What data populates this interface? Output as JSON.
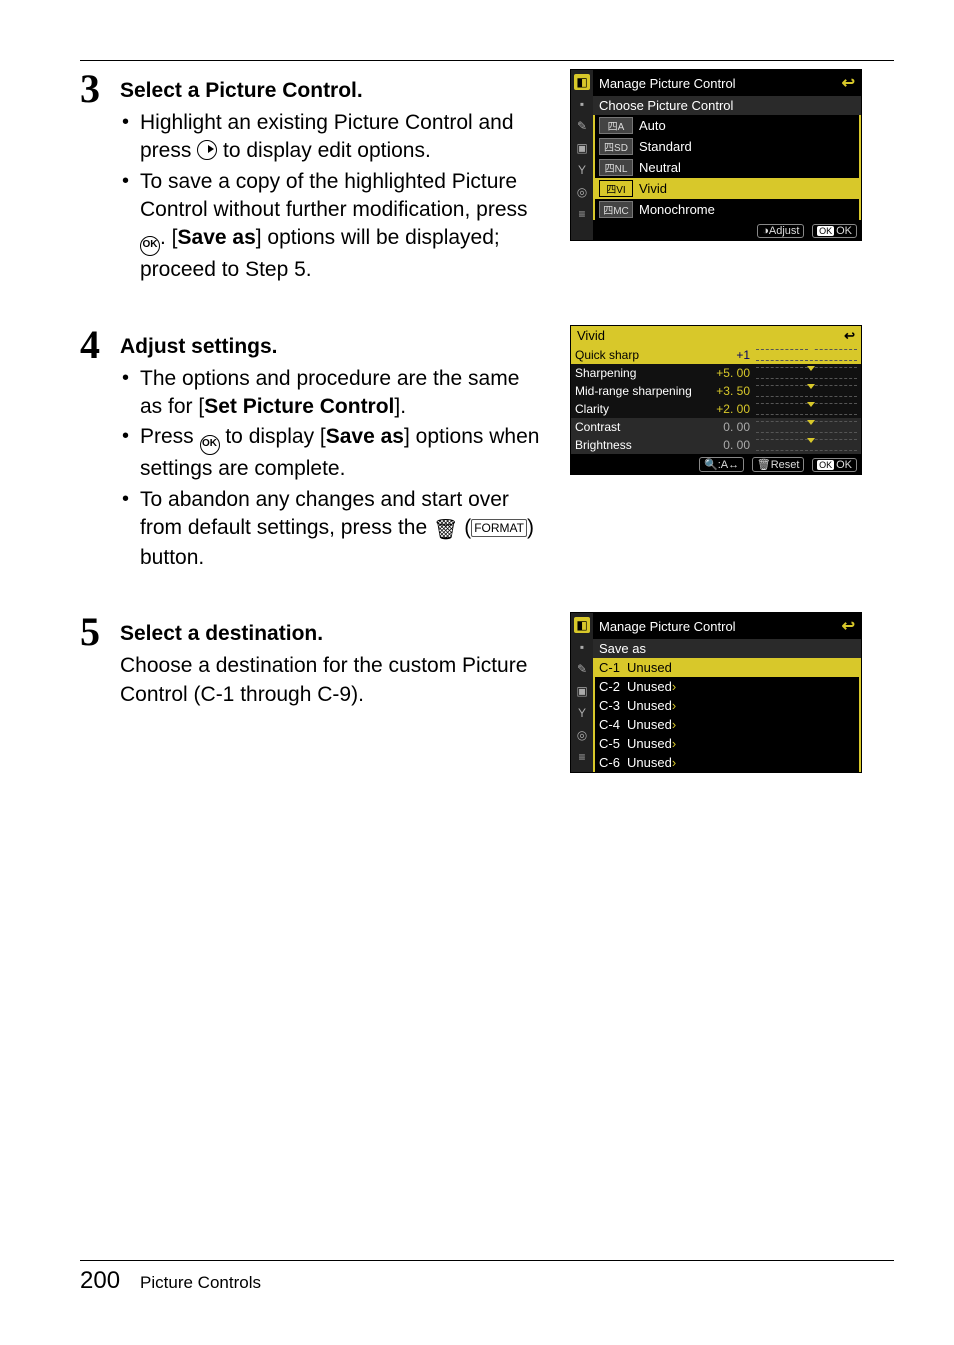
{
  "steps": {
    "s3": {
      "num": "3",
      "heading": "Select a Picture Control.",
      "bullets": [
        {
          "pre": "Highlight an existing Picture Control and press ",
          "sym": "right",
          "post": " to display edit options."
        },
        {
          "pre": "To save a copy of the highlighted Picture Control without further modification, press ",
          "sym": "ok",
          "post": ". [",
          "bold": "Save as",
          "post2": "] options will be displayed; proceed to Step 5."
        }
      ]
    },
    "s4": {
      "num": "4",
      "heading": "Adjust settings.",
      "bullets": [
        {
          "pre": "The options and procedure are the same as for [",
          "bold": "Set Picture Control",
          "post": "]."
        },
        {
          "pre": "Press ",
          "sym": "ok",
          "post": " to display [",
          "bold": "Save as",
          "post2": "] options when settings are complete."
        },
        {
          "pre": "To abandon any changes and start over from default settings, press the ",
          "sym": "trash",
          "post": " (",
          "sym2": "format",
          "post2": ") button."
        }
      ]
    },
    "s5": {
      "num": "5",
      "heading": "Select a destination.",
      "para": "Choose a destination for the custom Picture Control (C-1 through C-9)."
    }
  },
  "shot1": {
    "title": "Manage Picture Control",
    "subtitle": "Choose Picture Control",
    "items": [
      {
        "tag": "四A",
        "label": "Auto"
      },
      {
        "tag": "四SD",
        "label": "Standard"
      },
      {
        "tag": "四NL",
        "label": "Neutral"
      },
      {
        "tag": "四VI",
        "label": "Vivid",
        "selected": true
      },
      {
        "tag": "四MC",
        "label": "Monochrome"
      }
    ],
    "footer": {
      "adjust": "Adjust",
      "ok": "OK"
    }
  },
  "shot2": {
    "title": "Vivid",
    "rows": [
      {
        "name": "Quick sharp",
        "val": "+1",
        "selected": true
      },
      {
        "name": "Sharpening",
        "val": "+5. 00"
      },
      {
        "name": "Mid-range sharpening",
        "val": "+3. 50"
      },
      {
        "name": "Clarity",
        "val": "+2. 00"
      },
      {
        "name": "Contrast",
        "val": "0. 00",
        "dark": true
      },
      {
        "name": "Brightness",
        "val": "0. 00",
        "dark": true
      }
    ],
    "footer": {
      "zoom": "A↔",
      "reset": "Reset",
      "ok": "OK"
    }
  },
  "shot3": {
    "title": "Manage Picture Control",
    "subtitle": "Save as",
    "items": [
      {
        "tag": "C-1",
        "label": "Unused",
        "selected": true
      },
      {
        "tag": "C-2",
        "label": "Unused"
      },
      {
        "tag": "C-3",
        "label": "Unused"
      },
      {
        "tag": "C-4",
        "label": "Unused"
      },
      {
        "tag": "C-5",
        "label": "Unused"
      },
      {
        "tag": "C-6",
        "label": "Unused"
      }
    ]
  },
  "footer": {
    "page": "200",
    "section": "Picture Controls"
  },
  "glyphs": {
    "ok": "OK",
    "trash": "🗑",
    "format": "FORMAT",
    "back": "↩",
    "adjusticon": "◑"
  }
}
